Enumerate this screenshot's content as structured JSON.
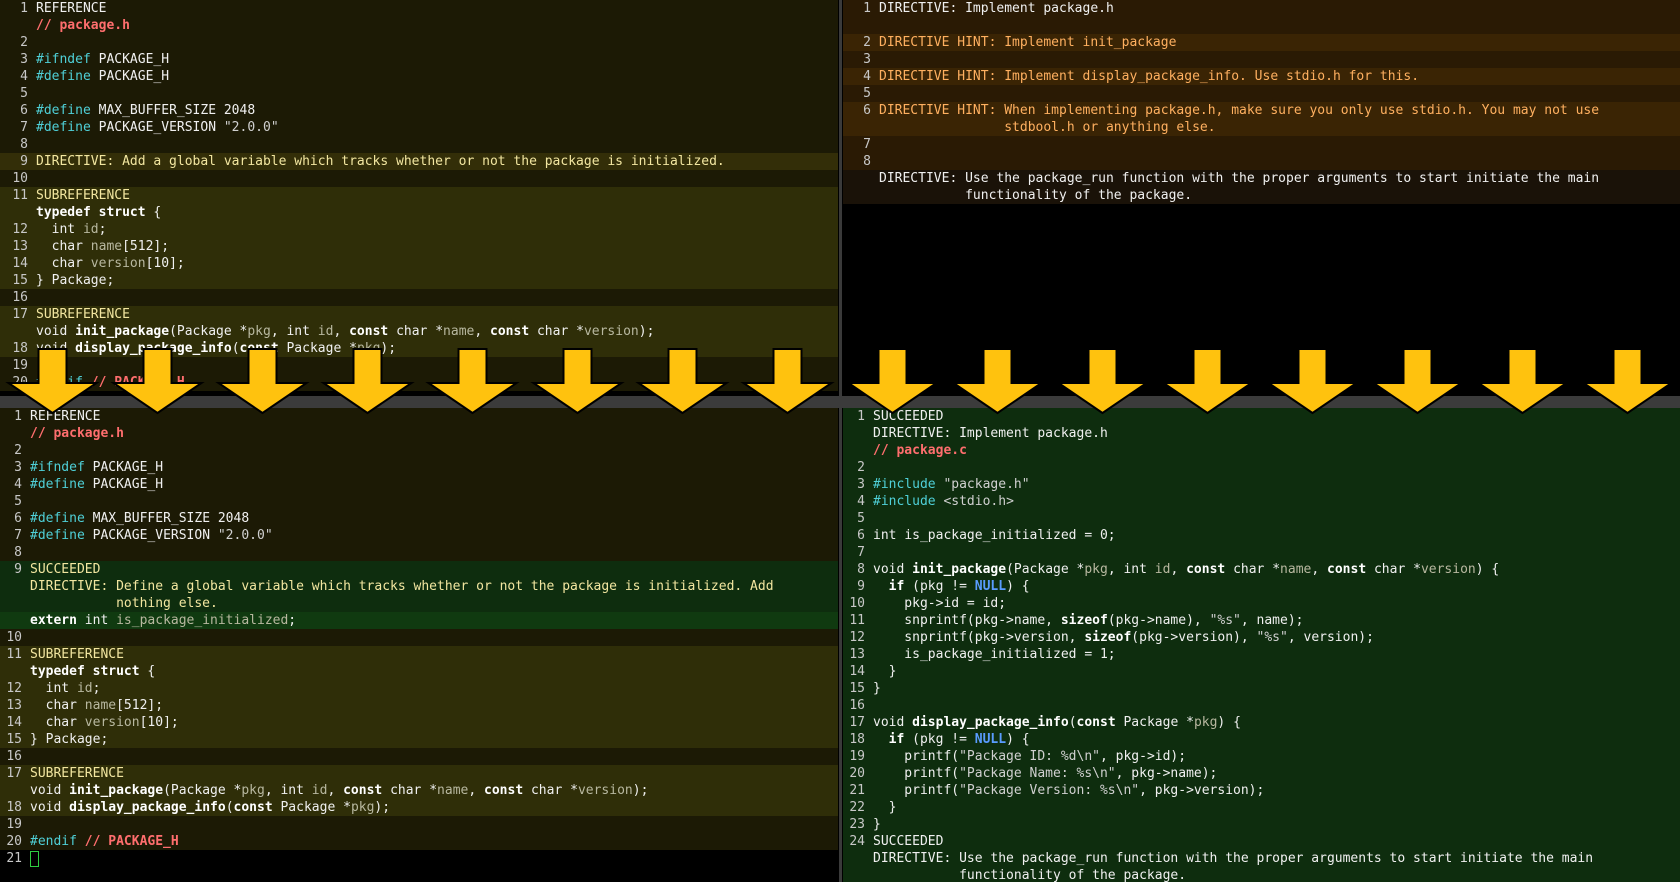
{
  "top_left": [
    {
      "n": "1",
      "bg": "bg-ref",
      "segs": [
        [
          "REFERENCE",
          "c-white"
        ]
      ]
    },
    {
      "n": "",
      "bg": "bg-ref",
      "segs": [
        [
          "// package.h",
          "c-red"
        ]
      ]
    },
    {
      "n": "2",
      "bg": "bg-ref",
      "segs": []
    },
    {
      "n": "3",
      "bg": "bg-ref",
      "segs": [
        [
          "#ifndef",
          "c-cyan"
        ],
        [
          " PACKAGE_H",
          "c-white"
        ]
      ]
    },
    {
      "n": "4",
      "bg": "bg-ref",
      "segs": [
        [
          "#define",
          "c-cyan"
        ],
        [
          " PACKAGE_H",
          "c-white"
        ]
      ]
    },
    {
      "n": "5",
      "bg": "bg-ref",
      "segs": []
    },
    {
      "n": "6",
      "bg": "bg-ref",
      "segs": [
        [
          "#define",
          "c-cyan"
        ],
        [
          " MAX_BUFFER_SIZE ",
          "c-white"
        ],
        [
          "2048",
          "c-white"
        ]
      ]
    },
    {
      "n": "7",
      "bg": "bg-ref",
      "segs": [
        [
          "#define",
          "c-cyan"
        ],
        [
          " PACKAGE_VERSION ",
          "c-white"
        ],
        [
          "\"2.0.0\"",
          "c-str"
        ]
      ]
    },
    {
      "n": "8",
      "bg": "bg-ref",
      "segs": []
    },
    {
      "n": "9",
      "bg": "bg-dir",
      "segs": [
        [
          "DIRECTIVE: Add a global variable which tracks whether or not the package is initialized.",
          "c-dirtxt"
        ]
      ]
    },
    {
      "n": "10",
      "bg": "bg-ref",
      "segs": []
    },
    {
      "n": "11",
      "bg": "bg-sub",
      "segs": [
        [
          "SUBREFERENCE",
          "c-dirtxt"
        ]
      ]
    },
    {
      "n": "",
      "bg": "bg-sub",
      "segs": [
        [
          "typedef struct",
          "c-kw"
        ],
        [
          " {",
          "c-white"
        ]
      ]
    },
    {
      "n": "12",
      "bg": "bg-sub",
      "segs": [
        [
          "  int ",
          "c-white"
        ],
        [
          "id",
          "c-dim"
        ],
        [
          ";",
          "c-white"
        ]
      ]
    },
    {
      "n": "13",
      "bg": "bg-sub",
      "segs": [
        [
          "  char ",
          "c-white"
        ],
        [
          "name",
          "c-dim"
        ],
        [
          "[512];",
          "c-white"
        ]
      ]
    },
    {
      "n": "14",
      "bg": "bg-sub",
      "segs": [
        [
          "  char ",
          "c-white"
        ],
        [
          "version",
          "c-dim"
        ],
        [
          "[10];",
          "c-white"
        ]
      ]
    },
    {
      "n": "15",
      "bg": "bg-sub",
      "segs": [
        [
          "} Package;",
          "c-white"
        ]
      ]
    },
    {
      "n": "16",
      "bg": "bg-ref",
      "segs": []
    },
    {
      "n": "17",
      "bg": "bg-sub",
      "segs": [
        [
          "SUBREFERENCE",
          "c-dirtxt"
        ]
      ]
    },
    {
      "n": "",
      "bg": "bg-sub",
      "segs": [
        [
          "void ",
          "c-white"
        ],
        [
          "init_package",
          "c-kw"
        ],
        [
          "(Package *",
          "c-white"
        ],
        [
          "pkg",
          "c-dim"
        ],
        [
          ", int ",
          "c-white"
        ],
        [
          "id",
          "c-dim"
        ],
        [
          ", ",
          "c-white"
        ],
        [
          "const",
          "c-kw"
        ],
        [
          " char *",
          "c-white"
        ],
        [
          "name",
          "c-dim"
        ],
        [
          ", ",
          "c-white"
        ],
        [
          "const",
          "c-kw"
        ],
        [
          " char *",
          "c-white"
        ],
        [
          "version",
          "c-dim"
        ],
        [
          ");",
          "c-white"
        ]
      ]
    },
    {
      "n": "18",
      "bg": "bg-sub",
      "segs": [
        [
          "void ",
          "c-white"
        ],
        [
          "display_package_info",
          "c-kw"
        ],
        [
          "(",
          "c-white"
        ],
        [
          "const",
          "c-kw"
        ],
        [
          " Package *",
          "c-white"
        ],
        [
          "pkg",
          "c-dim"
        ],
        [
          ");",
          "c-white"
        ]
      ]
    },
    {
      "n": "19",
      "bg": "bg-ref",
      "segs": []
    },
    {
      "n": "20",
      "bg": "bg-ref",
      "segs": [
        [
          "#endif",
          "c-cyan"
        ],
        [
          " // PACKAGE_H",
          "c-red"
        ]
      ]
    }
  ],
  "top_right": [
    {
      "n": "1",
      "bg": "bg-tr1",
      "segs": [
        [
          "DIRECTIVE: Implement package.h",
          "c-white"
        ]
      ]
    },
    {
      "n": "",
      "bg": "bg-tr1",
      "segs": []
    },
    {
      "n": "2",
      "bg": "bg-tr2",
      "segs": [
        [
          "DIRECTIVE HINT: Implement init_package",
          "c-hint"
        ]
      ]
    },
    {
      "n": "3",
      "bg": "bg-tr1",
      "segs": []
    },
    {
      "n": "4",
      "bg": "bg-tr2",
      "segs": [
        [
          "DIRECTIVE HINT: Implement display_package_info. Use stdio.h for this.",
          "c-hint"
        ]
      ]
    },
    {
      "n": "5",
      "bg": "bg-tr1",
      "segs": []
    },
    {
      "n": "6",
      "bg": "bg-tr2",
      "segs": [
        [
          "DIRECTIVE HINT: When implementing package.h, make sure you only use stdio.h. You may not use",
          "c-hint"
        ]
      ]
    },
    {
      "n": "",
      "bg": "bg-tr2",
      "segs": [
        [
          "                stdbool.h or anything else.",
          "c-hint"
        ]
      ]
    },
    {
      "n": "7",
      "bg": "bg-tr1",
      "segs": []
    },
    {
      "n": "8",
      "bg": "bg-tr1",
      "segs": []
    },
    {
      "n": "",
      "bg": "bg-tr3",
      "segs": [
        [
          "DIRECTIVE: Use the package_run function with the proper arguments to start initiate the main",
          "c-white"
        ]
      ]
    },
    {
      "n": "",
      "bg": "bg-tr3",
      "segs": [
        [
          "           functionality of the package.",
          "c-white"
        ]
      ]
    }
  ],
  "bottom_left": [
    {
      "n": "1",
      "bg": "bg-ref",
      "segs": [
        [
          "REFERENCE",
          "c-white"
        ]
      ]
    },
    {
      "n": "",
      "bg": "bg-ref",
      "segs": [
        [
          "// package.h",
          "c-red"
        ]
      ]
    },
    {
      "n": "2",
      "bg": "bg-ref",
      "segs": []
    },
    {
      "n": "3",
      "bg": "bg-ref",
      "segs": [
        [
          "#ifndef",
          "c-cyan"
        ],
        [
          " PACKAGE_H",
          "c-white"
        ]
      ]
    },
    {
      "n": "4",
      "bg": "bg-ref",
      "segs": [
        [
          "#define",
          "c-cyan"
        ],
        [
          " PACKAGE_H",
          "c-white"
        ]
      ]
    },
    {
      "n": "5",
      "bg": "bg-ref",
      "segs": []
    },
    {
      "n": "6",
      "bg": "bg-ref",
      "segs": [
        [
          "#define",
          "c-cyan"
        ],
        [
          " MAX_BUFFER_SIZE ",
          "c-white"
        ],
        [
          "2048",
          "c-white"
        ]
      ]
    },
    {
      "n": "7",
      "bg": "bg-ref",
      "segs": [
        [
          "#define",
          "c-cyan"
        ],
        [
          " PACKAGE_VERSION ",
          "c-white"
        ],
        [
          "\"2.0.0\"",
          "c-str"
        ]
      ]
    },
    {
      "n": "8",
      "bg": "bg-ref",
      "segs": []
    },
    {
      "n": "9",
      "bg": "bg-green",
      "segs": [
        [
          "SUCCEEDED",
          "c-dirtxt"
        ]
      ]
    },
    {
      "n": "",
      "bg": "bg-green",
      "segs": [
        [
          "DIRECTIVE: Define a global variable which tracks whether or not the package is initialized. Add",
          "c-dirtxt"
        ]
      ]
    },
    {
      "n": "",
      "bg": "bg-green",
      "segs": [
        [
          "           nothing else.",
          "c-dirtxt"
        ]
      ]
    },
    {
      "n": "",
      "bg": "bg-green2",
      "segs": [
        [
          "extern",
          "c-kw"
        ],
        [
          " int ",
          "c-white"
        ],
        [
          "is_package_initialized",
          "c-dim"
        ],
        [
          ";",
          "c-white"
        ]
      ]
    },
    {
      "n": "10",
      "bg": "bg-ref",
      "segs": []
    },
    {
      "n": "11",
      "bg": "bg-sub",
      "segs": [
        [
          "SUBREFERENCE",
          "c-dirtxt"
        ]
      ]
    },
    {
      "n": "",
      "bg": "bg-sub",
      "segs": [
        [
          "typedef struct",
          "c-kw"
        ],
        [
          " {",
          "c-white"
        ]
      ]
    },
    {
      "n": "12",
      "bg": "bg-sub",
      "segs": [
        [
          "  int ",
          "c-white"
        ],
        [
          "id",
          "c-dim"
        ],
        [
          ";",
          "c-white"
        ]
      ]
    },
    {
      "n": "13",
      "bg": "bg-sub",
      "segs": [
        [
          "  char ",
          "c-white"
        ],
        [
          "name",
          "c-dim"
        ],
        [
          "[512];",
          "c-white"
        ]
      ]
    },
    {
      "n": "14",
      "bg": "bg-sub",
      "segs": [
        [
          "  char ",
          "c-white"
        ],
        [
          "version",
          "c-dim"
        ],
        [
          "[10];",
          "c-white"
        ]
      ]
    },
    {
      "n": "15",
      "bg": "bg-sub",
      "segs": [
        [
          "} Package;",
          "c-white"
        ]
      ]
    },
    {
      "n": "16",
      "bg": "bg-ref",
      "segs": []
    },
    {
      "n": "17",
      "bg": "bg-sub",
      "segs": [
        [
          "SUBREFERENCE",
          "c-dirtxt"
        ]
      ]
    },
    {
      "n": "",
      "bg": "bg-sub",
      "segs": [
        [
          "void ",
          "c-white"
        ],
        [
          "init_package",
          "c-kw"
        ],
        [
          "(Package *",
          "c-white"
        ],
        [
          "pkg",
          "c-dim"
        ],
        [
          ", int ",
          "c-white"
        ],
        [
          "id",
          "c-dim"
        ],
        [
          ", ",
          "c-white"
        ],
        [
          "const",
          "c-kw"
        ],
        [
          " char *",
          "c-white"
        ],
        [
          "name",
          "c-dim"
        ],
        [
          ", ",
          "c-white"
        ],
        [
          "const",
          "c-kw"
        ],
        [
          " char *",
          "c-white"
        ],
        [
          "version",
          "c-dim"
        ],
        [
          ");",
          "c-white"
        ]
      ]
    },
    {
      "n": "18",
      "bg": "bg-sub",
      "segs": [
        [
          "void ",
          "c-white"
        ],
        [
          "display_package_info",
          "c-kw"
        ],
        [
          "(",
          "c-white"
        ],
        [
          "const",
          "c-kw"
        ],
        [
          " Package *",
          "c-white"
        ],
        [
          "pkg",
          "c-dim"
        ],
        [
          ");",
          "c-white"
        ]
      ]
    },
    {
      "n": "19",
      "bg": "bg-ref",
      "segs": []
    },
    {
      "n": "20",
      "bg": "bg-ref",
      "segs": [
        [
          "#endif",
          "c-cyan"
        ],
        [
          " // PACKAGE_H",
          "c-red"
        ]
      ]
    },
    {
      "n": "21",
      "bg": "",
      "segs": []
    }
  ],
  "bottom_right": [
    {
      "n": "1",
      "bg": "bg-green",
      "segs": [
        [
          "SUCCEEDED",
          "c-white"
        ]
      ]
    },
    {
      "n": "",
      "bg": "bg-green",
      "segs": [
        [
          "DIRECTIVE: Implement package.h",
          "c-white"
        ]
      ]
    },
    {
      "n": "",
      "bg": "bg-green",
      "segs": [
        [
          "// package.c",
          "c-red"
        ]
      ]
    },
    {
      "n": "2",
      "bg": "bg-green",
      "segs": []
    },
    {
      "n": "3",
      "bg": "bg-green",
      "segs": [
        [
          "#include",
          "c-cyan"
        ],
        [
          " \"package.h\"",
          "c-str"
        ]
      ]
    },
    {
      "n": "4",
      "bg": "bg-green",
      "segs": [
        [
          "#include",
          "c-cyan"
        ],
        [
          " <stdio.h>",
          "c-str"
        ]
      ]
    },
    {
      "n": "5",
      "bg": "bg-green",
      "segs": []
    },
    {
      "n": "6",
      "bg": "bg-green",
      "segs": [
        [
          "int ",
          "c-white"
        ],
        [
          "is_package_initialized = 0;",
          "c-white"
        ]
      ]
    },
    {
      "n": "7",
      "bg": "bg-green",
      "segs": []
    },
    {
      "n": "8",
      "bg": "bg-green",
      "segs": [
        [
          "void ",
          "c-white"
        ],
        [
          "init_package",
          "c-kw"
        ],
        [
          "(Package *",
          "c-white"
        ],
        [
          "pkg",
          "c-dim"
        ],
        [
          ", int ",
          "c-white"
        ],
        [
          "id",
          "c-dim"
        ],
        [
          ", ",
          "c-white"
        ],
        [
          "const",
          "c-kw"
        ],
        [
          " char *",
          "c-white"
        ],
        [
          "name",
          "c-dim"
        ],
        [
          ", ",
          "c-white"
        ],
        [
          "const",
          "c-kw"
        ],
        [
          " char *",
          "c-white"
        ],
        [
          "version",
          "c-dim"
        ],
        [
          ") {",
          "c-white"
        ]
      ]
    },
    {
      "n": "9",
      "bg": "bg-green",
      "segs": [
        [
          "  ",
          "c-white"
        ],
        [
          "if",
          "c-kw"
        ],
        [
          " (pkg != ",
          "c-white"
        ],
        [
          "NULL",
          "c-blue"
        ],
        [
          ") {",
          "c-white"
        ]
      ]
    },
    {
      "n": "10",
      "bg": "bg-green",
      "segs": [
        [
          "    pkg->id = id;",
          "c-white"
        ]
      ]
    },
    {
      "n": "11",
      "bg": "bg-green",
      "segs": [
        [
          "    snprintf(pkg->name, ",
          "c-white"
        ],
        [
          "sizeof",
          "c-kw"
        ],
        [
          "(pkg->name), ",
          "c-white"
        ],
        [
          "\"%s\"",
          "c-str"
        ],
        [
          ", name);",
          "c-white"
        ]
      ]
    },
    {
      "n": "12",
      "bg": "bg-green",
      "segs": [
        [
          "    snprintf(pkg->version, ",
          "c-white"
        ],
        [
          "sizeof",
          "c-kw"
        ],
        [
          "(pkg->version), ",
          "c-white"
        ],
        [
          "\"%s\"",
          "c-str"
        ],
        [
          ", version);",
          "c-white"
        ]
      ]
    },
    {
      "n": "13",
      "bg": "bg-green",
      "segs": [
        [
          "    is_package_initialized = 1;",
          "c-white"
        ]
      ]
    },
    {
      "n": "14",
      "bg": "bg-green",
      "segs": [
        [
          "  }",
          "c-white"
        ]
      ]
    },
    {
      "n": "15",
      "bg": "bg-green",
      "segs": [
        [
          "}",
          "c-white"
        ]
      ]
    },
    {
      "n": "16",
      "bg": "bg-green",
      "segs": []
    },
    {
      "n": "17",
      "bg": "bg-green",
      "segs": [
        [
          "void ",
          "c-white"
        ],
        [
          "display_package_info",
          "c-kw"
        ],
        [
          "(",
          "c-white"
        ],
        [
          "const",
          "c-kw"
        ],
        [
          " Package *",
          "c-white"
        ],
        [
          "pkg",
          "c-dim"
        ],
        [
          ") {",
          "c-white"
        ]
      ]
    },
    {
      "n": "18",
      "bg": "bg-green",
      "segs": [
        [
          "  ",
          "c-white"
        ],
        [
          "if",
          "c-kw"
        ],
        [
          " (pkg != ",
          "c-white"
        ],
        [
          "NULL",
          "c-blue"
        ],
        [
          ") {",
          "c-white"
        ]
      ]
    },
    {
      "n": "19",
      "bg": "bg-green",
      "segs": [
        [
          "    printf(",
          "c-white"
        ],
        [
          "\"Package ID: %d\\n\"",
          "c-str"
        ],
        [
          ", pkg->id);",
          "c-white"
        ]
      ]
    },
    {
      "n": "20",
      "bg": "bg-green",
      "segs": [
        [
          "    printf(",
          "c-white"
        ],
        [
          "\"Package Name: %s\\n\"",
          "c-str"
        ],
        [
          ", pkg->name);",
          "c-white"
        ]
      ]
    },
    {
      "n": "21",
      "bg": "bg-green",
      "segs": [
        [
          "    printf(",
          "c-white"
        ],
        [
          "\"Package Version: %s\\n\"",
          "c-str"
        ],
        [
          ", pkg->version);",
          "c-white"
        ]
      ]
    },
    {
      "n": "22",
      "bg": "bg-green",
      "segs": [
        [
          "  }",
          "c-white"
        ]
      ]
    },
    {
      "n": "23",
      "bg": "bg-green",
      "segs": [
        [
          "}",
          "c-white"
        ]
      ]
    },
    {
      "n": "24",
      "bg": "bg-green",
      "segs": [
        [
          "SUCCEEDED",
          "c-white"
        ]
      ]
    },
    {
      "n": "",
      "bg": "bg-green",
      "segs": [
        [
          "DIRECTIVE: Use the package_run function with the proper arguments to start initiate the main",
          "c-white"
        ]
      ]
    },
    {
      "n": "",
      "bg": "bg-green",
      "segs": [
        [
          "           functionality of the package.",
          "c-white"
        ]
      ]
    }
  ],
  "colors": {
    "arrow": "#ffc20e",
    "arrow_stroke": "#000000"
  },
  "arrow_count": 16
}
